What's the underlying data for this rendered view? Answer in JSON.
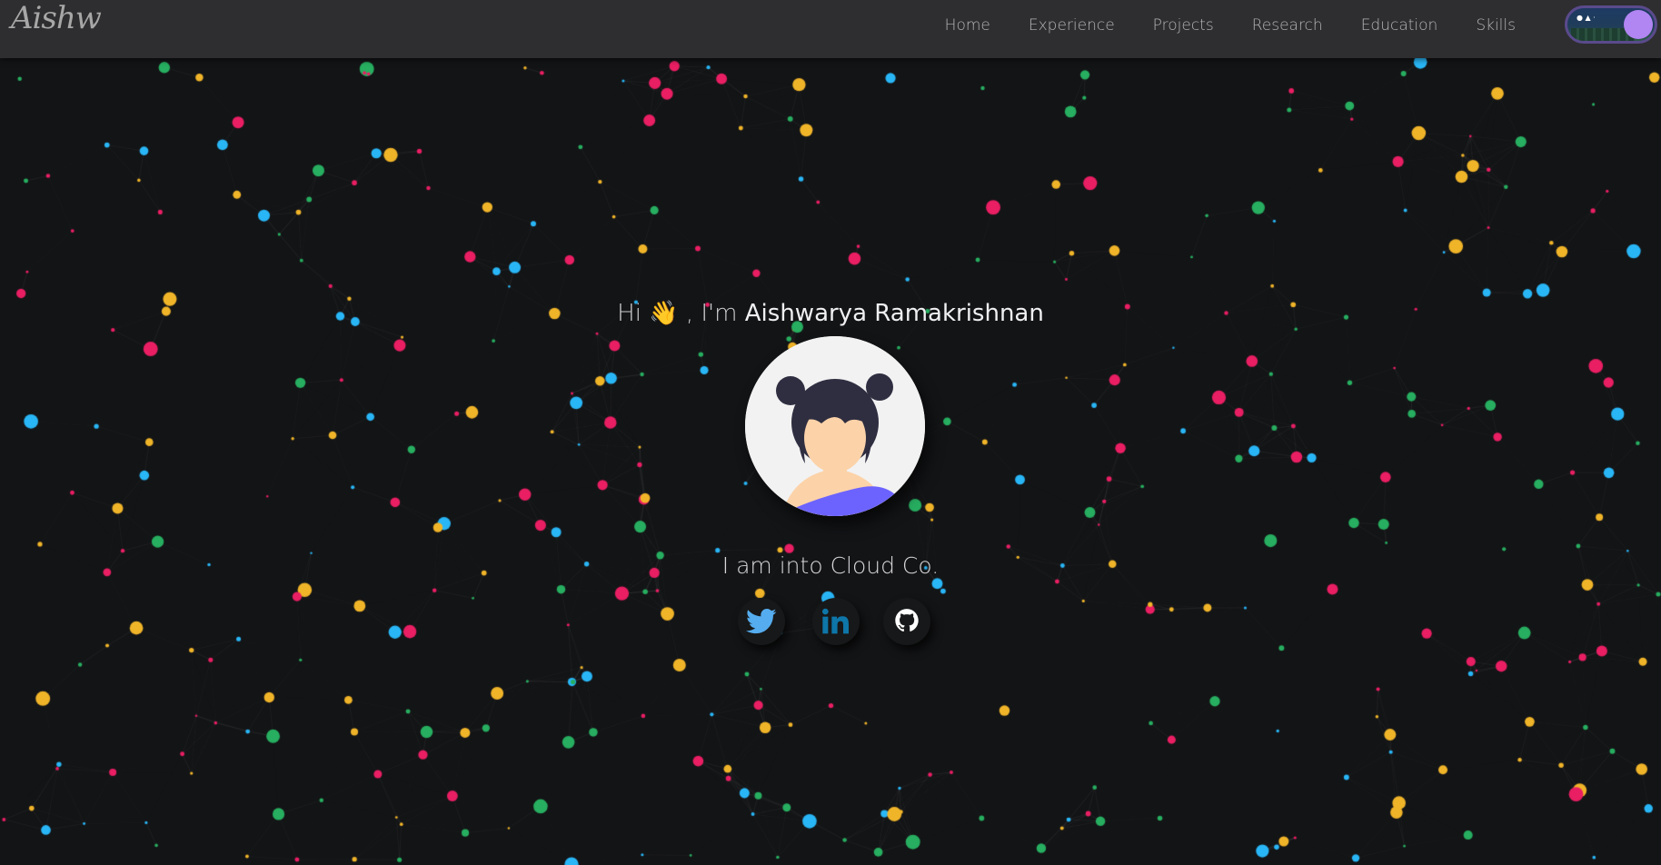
{
  "logo": {
    "text": "Aishw"
  },
  "nav": {
    "items": [
      {
        "label": "Home"
      },
      {
        "label": "Experience"
      },
      {
        "label": "Projects"
      },
      {
        "label": "Research"
      },
      {
        "label": "Education"
      },
      {
        "label": "Skills"
      }
    ],
    "theme_toggle": {
      "icon": "night-scene-toggle-icon",
      "knob_color": "#b185f2"
    }
  },
  "hero": {
    "greeting_prefix": "Hi",
    "wave_emoji": "👋",
    "greeting_mid": ", I'm",
    "name": "Aishwarya Ramakrishnan",
    "tagline": "I am into Cloud Co.",
    "avatar_icon": "girl-avatar-icon"
  },
  "social": [
    {
      "name": "twitter",
      "icon": "twitter-icon",
      "color": "#55acee"
    },
    {
      "name": "linkedin",
      "icon": "linkedin-icon",
      "color": "#0e76a8"
    },
    {
      "name": "github",
      "icon": "github-icon",
      "color": "#ffffff"
    }
  ],
  "theme": {
    "background": "#131416",
    "navbar": "#2e2e30",
    "particle_colors": [
      "#e91e63",
      "#29b6f6",
      "#27ae60",
      "#f0b429"
    ]
  }
}
